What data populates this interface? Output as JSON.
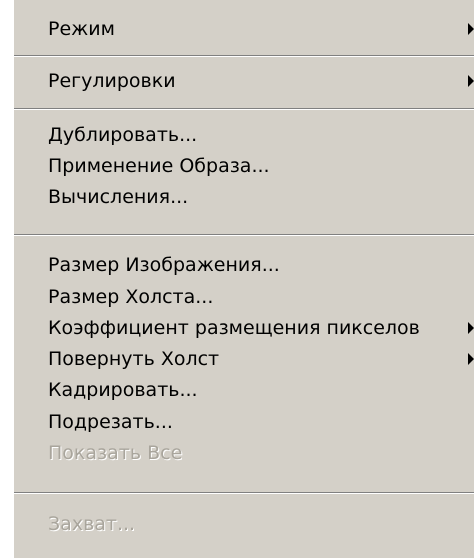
{
  "menu": {
    "items": [
      {
        "label": "Режим",
        "has_submenu": true,
        "disabled": false
      },
      {
        "label": "Регулировки",
        "has_submenu": true,
        "disabled": false
      },
      {
        "label": "Дублировать...",
        "has_submenu": false,
        "disabled": false
      },
      {
        "label": "Применение Образа...",
        "has_submenu": false,
        "disabled": false
      },
      {
        "label": "Вычисления...",
        "has_submenu": false,
        "disabled": false
      },
      {
        "label": "Размер Изображения...",
        "has_submenu": false,
        "disabled": false
      },
      {
        "label": "Размер Холста...",
        "has_submenu": false,
        "disabled": false
      },
      {
        "label": "Коэффициент размещения пикселов",
        "has_submenu": true,
        "disabled": false
      },
      {
        "label": "Повернуть Холст",
        "has_submenu": true,
        "disabled": false
      },
      {
        "label": "Кадрировать...",
        "has_submenu": false,
        "disabled": false
      },
      {
        "label": "Подрезать...",
        "has_submenu": false,
        "disabled": false
      },
      {
        "label": "Показать Все",
        "has_submenu": false,
        "disabled": true
      },
      {
        "label": "Захват...",
        "has_submenu": false,
        "disabled": true
      }
    ]
  },
  "colors": {
    "menu_background": "#d4d0c8",
    "text": "#000000",
    "disabled_text": "#a9a59c"
  }
}
